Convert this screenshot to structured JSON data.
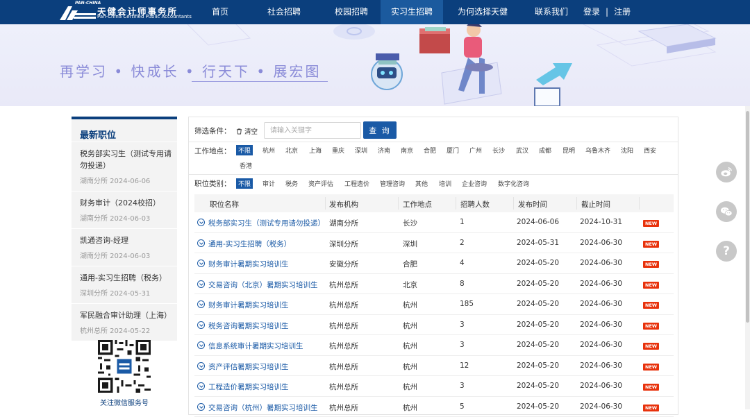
{
  "header": {
    "logo_cn": "天健会计师事务所",
    "logo_en": "Pan-China Certified Public Accountants",
    "logo_tag": "PAN-CHINA",
    "nav": [
      {
        "label": "首页"
      },
      {
        "label": "社会招聘"
      },
      {
        "label": "校园招聘"
      },
      {
        "label": "实习生招聘",
        "active": true
      },
      {
        "label": "为何选择天健"
      },
      {
        "label": "联系我们"
      }
    ],
    "login": "登录",
    "separator": "|",
    "register": "注册"
  },
  "banner": {
    "slogan": "再学习 • 快成长 • 行天下 • 展宏图"
  },
  "sidebar": {
    "title": "最新职位",
    "items": [
      {
        "title": "税务部实习生（测试专用请勿投递）",
        "meta": "湖南分所 2024-06-06"
      },
      {
        "title": "财务审计（2024校招）",
        "meta": "湖南分所 2024-06-03"
      },
      {
        "title": "凯通咨询-经理",
        "meta": "湖南分所 2024-06-03"
      },
      {
        "title": "通用-实习生招聘（税务）",
        "meta": "深圳分所 2024-05-31"
      },
      {
        "title": "军民融合审计助理（上海）",
        "meta": "杭州总所 2024-05-22"
      }
    ],
    "qr_caption": "关注微信服务号"
  },
  "filters": {
    "label": "筛选条件：",
    "clear": "清空",
    "search_placeholder": "请输入关键字",
    "search_button": "查 询",
    "location_label": "工作地点：",
    "locations": [
      "不限",
      "杭州",
      "北京",
      "上海",
      "重庆",
      "深圳",
      "济南",
      "南京",
      "合肥",
      "厦门",
      "广州",
      "长沙",
      "武汉",
      "成都",
      "昆明",
      "乌鲁木齐",
      "沈阳",
      "西安",
      "香港"
    ],
    "category_label": "职位类别：",
    "categories": [
      "不限",
      "审计",
      "税务",
      "资产评估",
      "工程造价",
      "管理咨询",
      "其他",
      "培训",
      "企业咨询",
      "数字化咨询"
    ]
  },
  "table": {
    "headers": [
      "职位名称",
      "发布机构",
      "工作地点",
      "招聘人数",
      "发布时间",
      "截止时间"
    ],
    "new_badge": "NEW",
    "rows": [
      {
        "name": "税务部实习生（测试专用请勿投递）",
        "org": "湖南分所",
        "loc": "长沙",
        "count": "1",
        "pub": "2024-06-06",
        "end": "2024-10-31"
      },
      {
        "name": "通用-实习生招聘（税务）",
        "org": "深圳分所",
        "loc": "深圳",
        "count": "2",
        "pub": "2024-05-31",
        "end": "2024-06-30"
      },
      {
        "name": "财务审计暑期实习培训生",
        "org": "安徽分所",
        "loc": "合肥",
        "count": "4",
        "pub": "2024-05-20",
        "end": "2024-06-30"
      },
      {
        "name": "交易咨询（北京）暑期实习培训生",
        "org": "杭州总所",
        "loc": "北京",
        "count": "8",
        "pub": "2024-05-20",
        "end": "2024-06-30"
      },
      {
        "name": "财务审计暑期实习培训生",
        "org": "杭州总所",
        "loc": "杭州",
        "count": "185",
        "pub": "2024-05-20",
        "end": "2024-06-30"
      },
      {
        "name": "税务咨询暑期实习培训生",
        "org": "杭州总所",
        "loc": "杭州",
        "count": "3",
        "pub": "2024-05-20",
        "end": "2024-06-30"
      },
      {
        "name": "信息系统审计暑期实习培训生",
        "org": "杭州总所",
        "loc": "杭州",
        "count": "3",
        "pub": "2024-05-20",
        "end": "2024-06-30"
      },
      {
        "name": "资产评估暑期实习培训生",
        "org": "杭州总所",
        "loc": "杭州",
        "count": "12",
        "pub": "2024-05-20",
        "end": "2024-06-30"
      },
      {
        "name": "工程造价暑期实习培训生",
        "org": "杭州总所",
        "loc": "杭州",
        "count": "3",
        "pub": "2024-05-20",
        "end": "2024-06-30"
      },
      {
        "name": "交易咨询（杭州）暑期实习培训生",
        "org": "杭州总所",
        "loc": "杭州",
        "count": "5",
        "pub": "2024-05-20",
        "end": "2024-06-30"
      }
    ]
  },
  "floating": {
    "help": "?"
  }
}
